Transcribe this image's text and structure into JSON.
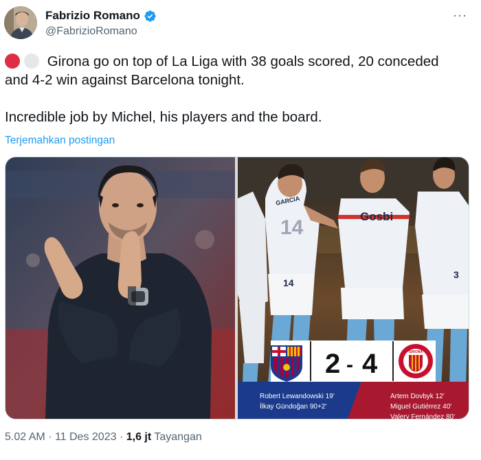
{
  "author": {
    "name": "Fabrizio Romano",
    "handle": "@FabrizioRomano",
    "verified": true,
    "avatar_icon": "profile-avatar"
  },
  "more_icon": "more-options-icon",
  "tweet": {
    "line1": "Girona go on top of La Liga with 38 goals scored, 20 conceded",
    "line2": "and 4-2 win against Barcelona tonight.",
    "line3": "Incredible job by Michel, his players and the board.",
    "emoji_circles": [
      "red-circle",
      "white-circle"
    ]
  },
  "translate_label": "Terjemahkan postingan",
  "scoreboard": {
    "home_score": "2",
    "away_score": "4",
    "separator": "-",
    "home_scorers": [
      "Robert Lewandowski 19'",
      "İlkay Gündoğan 90+2'"
    ],
    "away_scorers": [
      "Artem Dovbyk 12'",
      "Miguel Gutiérrez 40'",
      "Valery Fernández 80'"
    ],
    "home_crest": "barcelona-crest",
    "away_crest": "girona-crest",
    "away_crest_text": "GIRONA"
  },
  "jersey": {
    "sponsor": "Gosbi",
    "number_left": "14",
    "number_name": "GARCIA",
    "number_right": "3"
  },
  "meta": {
    "time": "5.02 AM",
    "date": "11 Des 2023",
    "views": "1,6 jt",
    "views_label": "Tayangan"
  },
  "colors": {
    "accent": "#1d9bf0",
    "barca_blue": "#1b3a8c",
    "girona_red": "#c8102e"
  }
}
